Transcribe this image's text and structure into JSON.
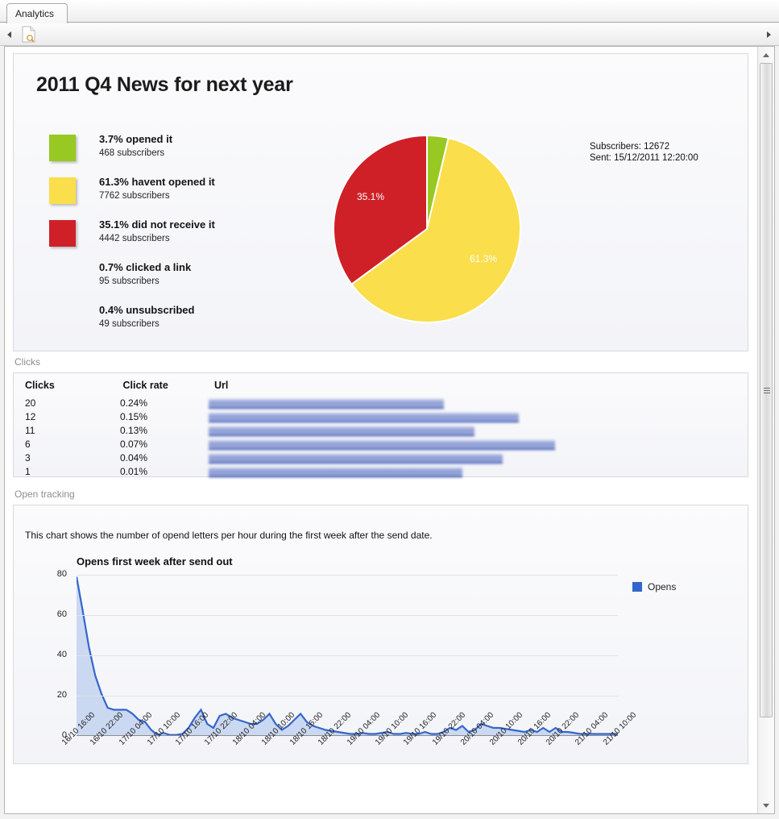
{
  "window": {
    "tab_label": "Analytics",
    "toolbar": {
      "back_arrow": "◀",
      "forward_arrow": "▶",
      "preview_icon": "document-preview-icon"
    },
    "scrollbar": {
      "up_arrow": "▲",
      "down_arrow": "▼"
    }
  },
  "report": {
    "title": "2011 Q4 News for next year",
    "stats": [
      {
        "title": "3.7% opened it",
        "sub": "468 subscribers",
        "color": "#97c922",
        "has_swatch": true
      },
      {
        "title": "61.3% havent opened it",
        "sub": "7762 subscribers",
        "color": "#fade4b",
        "has_swatch": true
      },
      {
        "title": "35.1% did not receive it",
        "sub": "4442 subscribers",
        "color": "#cf2027",
        "has_swatch": true
      },
      {
        "title": "0.7% clicked a link",
        "sub": "95 subscribers",
        "color": "",
        "has_swatch": false
      },
      {
        "title": "0.4% unsubscribed",
        "sub": "49 subscribers",
        "color": "",
        "has_swatch": false
      }
    ],
    "meta": {
      "subscribers_label": "Subscribers:",
      "subscribers_value": "12672",
      "sent_label": "Sent:",
      "sent_value": "15/12/2011 12:20:00"
    }
  },
  "sections": {
    "clicks_caption": "Clicks",
    "open_tracking_caption": "Open tracking",
    "open_tracking_desc": "This chart shows the number of opend letters per hour during the first week after the send date."
  },
  "clicks_table": {
    "headers": [
      "Clicks",
      "Click rate",
      "Url"
    ],
    "rows": [
      {
        "clicks": "20",
        "rate": "0.24%",
        "url_width": 292
      },
      {
        "clicks": "12",
        "rate": "0.15%",
        "url_width": 385
      },
      {
        "clicks": "11",
        "rate": "0.13%",
        "url_width": 330
      },
      {
        "clicks": "6",
        "rate": "0.07%",
        "url_width": 430
      },
      {
        "clicks": "3",
        "rate": "0.04%",
        "url_width": 365
      },
      {
        "clicks": "1",
        "rate": "0.01%",
        "url_width": 315
      }
    ]
  },
  "chart_data": [
    {
      "type": "pie",
      "title": "",
      "labels": [
        "3.7% opened it",
        "61.3% havent opened it",
        "35.1% did not receive it"
      ],
      "values": [
        3.7,
        61.3,
        35.1
      ],
      "colors": [
        "#97c922",
        "#fade4b",
        "#cf2027"
      ],
      "data_labels": [
        "",
        "61.3%",
        "35.1%"
      ],
      "start_angle_deg": 0,
      "direction": "clockwise",
      "legend_position": "left"
    },
    {
      "type": "area",
      "title": "Opens first week after send out",
      "xlabel": "",
      "ylabel": "",
      "ylim": [
        0,
        80
      ],
      "yticks": [
        0,
        20,
        40,
        60,
        80
      ],
      "grid": true,
      "legend_position": "right",
      "series": [
        {
          "name": "Opens",
          "color": "#3366cc",
          "fill": "#c3d2f0",
          "values": [
            79,
            62,
            44,
            30,
            21,
            14,
            13,
            13,
            13,
            11,
            8,
            7,
            3,
            0.5,
            1.5,
            0.5,
            0.5,
            1,
            4,
            9,
            13,
            6,
            4,
            10,
            11,
            9,
            8,
            7,
            6,
            6,
            8,
            11,
            6,
            3,
            5,
            8,
            11,
            7,
            5,
            4,
            3,
            2.5,
            2,
            1.5,
            1,
            1,
            1.5,
            1,
            1,
            1.5,
            2,
            1,
            1,
            1.5,
            1,
            1,
            2,
            1,
            1,
            2,
            4,
            3,
            5,
            2,
            3,
            6,
            5,
            4,
            4,
            3.5,
            3,
            2.5,
            2,
            3,
            2,
            4,
            2,
            4,
            2,
            2,
            1.5,
            1,
            1,
            1,
            1,
            1,
            1,
            1
          ]
        }
      ],
      "xtick_labels": [
        "16/10 16:00",
        "16/10 22:00",
        "17/10 04:00",
        "17/10 10:00",
        "17/10 16:00",
        "17/10 22:00",
        "18/10 04:00",
        "18/10 10:00",
        "18/10 16:00",
        "18/10 22:00",
        "19/10 04:00",
        "19/10 10:00",
        "19/10 16:00",
        "19/10 22:00",
        "20/10 04:00",
        "20/10 10:00",
        "20/10 16:00",
        "20/10 22:00",
        "21/10 04:00",
        "21/10 10:00"
      ]
    }
  ]
}
